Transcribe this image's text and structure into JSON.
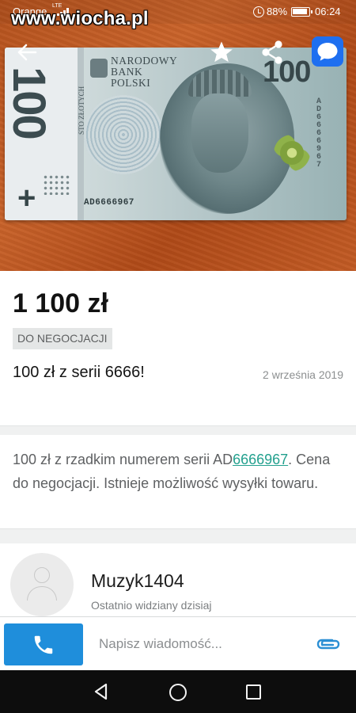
{
  "status_bar": {
    "carrier": "Orange",
    "network": "LTE",
    "watermark": "www.wiocha.pl",
    "battery": "88%",
    "time": "06:24"
  },
  "banknote": {
    "denomination": "100",
    "issuer_lines": [
      "NARODOWY",
      "BANK",
      "POLSKI"
    ],
    "side_text": "STO ZŁOTYCH",
    "serial": "AD6666967"
  },
  "listing": {
    "price": "1 100 zł",
    "badge": "DO NEGOCJACJI",
    "title": "100 zł z serii 6666!",
    "date": "2 września 2019",
    "description_prefix": "100 zł z rzadkim numerem serii AD",
    "description_link": "6666967",
    "description_suffix": ". Cena do negocjacji. Istnieje możliwość wysyłki towaru."
  },
  "seller": {
    "name": "Muzyk1404",
    "last_seen": "Ostatnio widziany dzisiaj"
  },
  "message_bar": {
    "placeholder": "Napisz wiadomość..."
  },
  "icons": {
    "back": "back-arrow-icon",
    "favorite": "star-icon",
    "share": "share-icon",
    "chat": "chat-bubble-icon",
    "call": "phone-icon",
    "attach": "paperclip-icon"
  },
  "colors": {
    "call_button": "#1f8edb",
    "chat_button": "#1e6ff0",
    "link": "#23a08e"
  }
}
